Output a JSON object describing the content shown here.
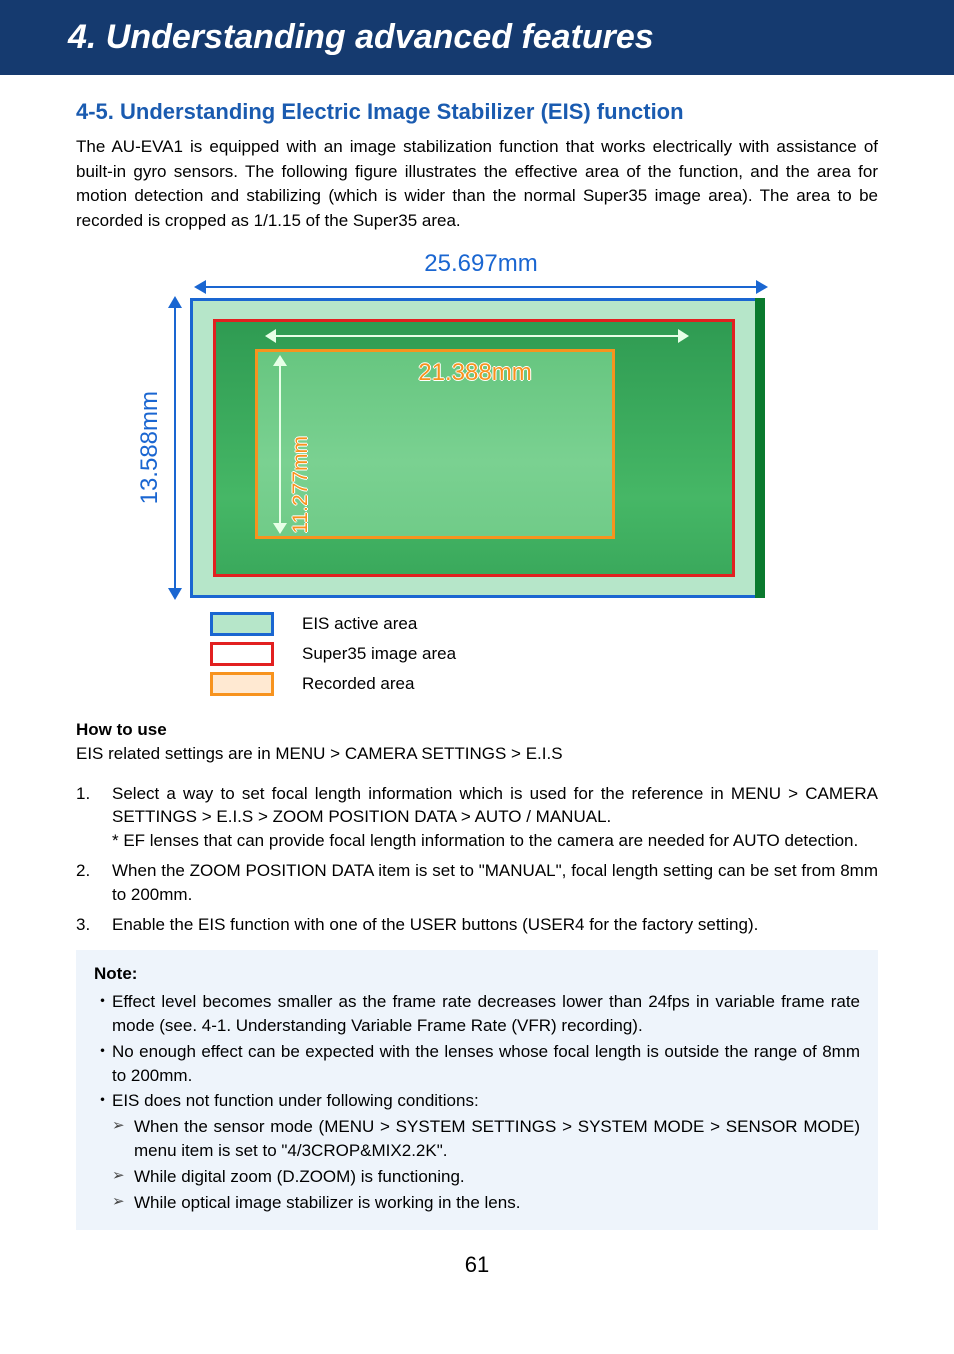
{
  "chapter_title": "4. Understanding advanced features",
  "section_title": "4-5. Understanding Electric Image Stabilizer (EIS) function",
  "intro": "The AU-EVA1 is equipped with an image stabilization function that works electrically with assistance of built-in gyro sensors. The following figure illustrates the effective area of the function, and the area for motion detection and stabilizing (which is wider than the normal Super35 image area). The area to be recorded is cropped as 1/1.15 of the Super35 area.",
  "figure": {
    "outer_width": "25.697mm",
    "outer_height": "13.588mm",
    "recorded_width": "21.388mm",
    "recorded_height": "11.277mm"
  },
  "legend": {
    "eis_active": "EIS active area",
    "super35": "Super35 image area",
    "recorded": "Recorded area"
  },
  "howto": {
    "heading": "How to use",
    "lead": "EIS related settings are in MENU > CAMERA SETTINGS > E.I.S",
    "steps": [
      {
        "main": "Select a way to set focal length information which is used for the reference in MENU > CAMERA SETTINGS > E.I.S > ZOOM POSITION DATA > AUTO / MANUAL.",
        "sub": "* EF lenses that can provide focal length information to the camera are needed for AUTO detection."
      },
      {
        "main": "When the ZOOM POSITION DATA item is set to \"MANUAL\", focal length setting can be set from 8mm to 200mm."
      },
      {
        "main": "Enable the EIS function with one of the USER buttons (USER4 for the factory setting)."
      }
    ]
  },
  "note": {
    "title": "Note:",
    "items": [
      "Effect level becomes smaller as the frame rate decreases lower than 24fps in variable frame rate mode (see. 4-1. Understanding Variable Frame Rate (VFR) recording).",
      "No enough effect can be expected with the lenses whose focal length is outside the range of 8mm to 200mm.",
      "EIS does not function under following conditions:"
    ],
    "sub_items": [
      "When the sensor mode (MENU > SYSTEM SETTINGS > SYSTEM MODE > SENSOR MODE) menu item is set to \"4/3CROP&MIX2.2K\".",
      "While digital zoom (D.ZOOM) is functioning.",
      "While optical image stabilizer is working in the lens."
    ]
  },
  "page_number": "61"
}
